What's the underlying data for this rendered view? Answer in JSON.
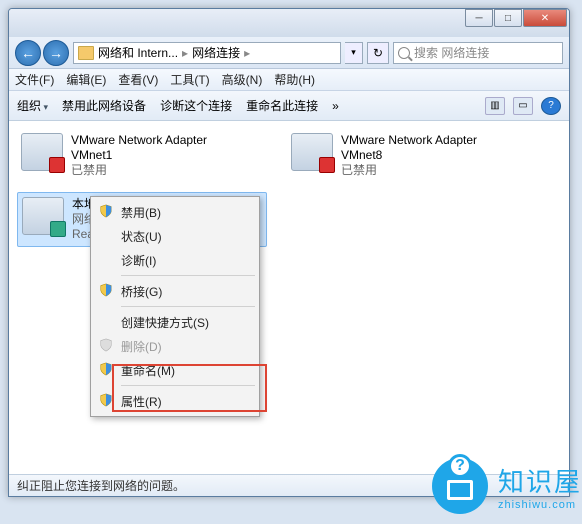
{
  "titlebar": {
    "minimize": "─",
    "maximize": "□",
    "close": "✕"
  },
  "nav": {
    "back": "←",
    "forward": "→"
  },
  "breadcrumb": {
    "level1": "网络和 Intern...",
    "level2": "网络连接",
    "sep": "▸"
  },
  "addr_dropdown": "▾",
  "refresh": "↻",
  "search": {
    "placeholder": "搜索 网络连接"
  },
  "menubar": {
    "file": "文件(F)",
    "edit": "编辑(E)",
    "view": "查看(V)",
    "tools": "工具(T)",
    "advanced": "高级(N)",
    "help": "帮助(H)"
  },
  "toolbar": {
    "organize": "组织",
    "disable": "禁用此网络设备",
    "diagnose": "诊断这个连接",
    "rename": "重命名此连接",
    "more": "»",
    "view_icons": "▥",
    "details": "▭",
    "help": "?"
  },
  "adapters": [
    {
      "name": "VMware Network Adapter",
      "name2": "VMnet1",
      "status": "已禁用"
    },
    {
      "name": "VMware Network Adapter",
      "name2": "VMnet8",
      "status": "已禁用"
    },
    {
      "name": "本地连接",
      "sub1": "网络",
      "sub2": "Realt"
    }
  ],
  "context_menu": {
    "disable": "禁用(B)",
    "status": "状态(U)",
    "diagnose": "诊断(I)",
    "bridge": "桥接(G)",
    "shortcut": "创建快捷方式(S)",
    "delete": "删除(D)",
    "rename": "重命名(M)",
    "properties": "属性(R)"
  },
  "statusbar": {
    "text": "纠正阻止您连接到网络的问题。"
  },
  "logo": {
    "q": "?",
    "text": "知识屋",
    "sub": "zhishiwu.com"
  }
}
